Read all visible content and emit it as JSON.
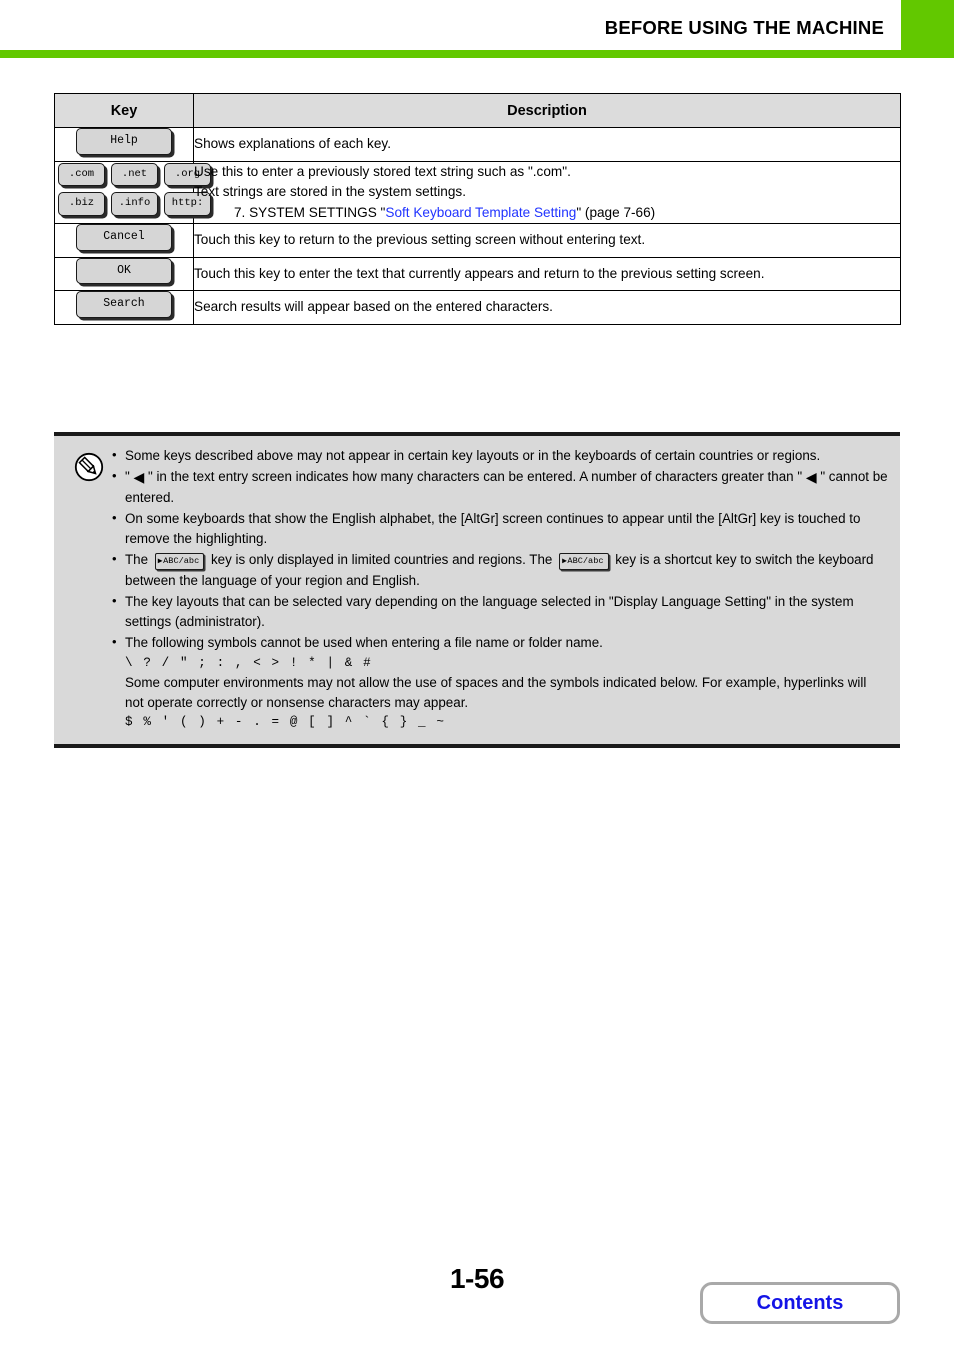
{
  "header": {
    "title": "BEFORE USING THE MACHINE",
    "accent_color": "#62c800"
  },
  "key_table": {
    "columns": [
      "Key",
      "Description"
    ],
    "rows": [
      {
        "keys": [
          [
            "Help"
          ]
        ],
        "description_lines": [
          "Shows explanations of each key."
        ],
        "indented_line": null,
        "link_prefix": null,
        "link_text": null,
        "link_suffix": null
      },
      {
        "keys": [
          [
            ".com",
            ".net",
            ".org"
          ],
          [
            ".biz",
            ".info",
            "http:"
          ]
        ],
        "description_lines": [
          "Use this to enter a previously stored text string such as \".com\".",
          "Text strings are stored in the system settings."
        ],
        "link_prefix": "7. SYSTEM SETTINGS \"",
        "link_text": "Soft Keyboard Template Setting",
        "link_suffix": "\" (page 7-66)"
      },
      {
        "keys": [
          [
            "Cancel"
          ]
        ],
        "description_lines": [
          "Touch this key to return to the previous setting screen without entering text."
        ],
        "link_prefix": null,
        "link_text": null,
        "link_suffix": null
      },
      {
        "keys": [
          [
            "OK"
          ]
        ],
        "description_lines": [
          "Touch this key to enter the text that currently appears and return to the previous setting screen."
        ],
        "link_prefix": null,
        "link_text": null,
        "link_suffix": null
      },
      {
        "keys": [
          [
            "Search"
          ]
        ],
        "description_lines": [
          "Search results will appear based on the entered characters."
        ],
        "link_prefix": null,
        "link_text": null,
        "link_suffix": null
      }
    ]
  },
  "note": {
    "icon": "pencil-note-icon",
    "bullets": [
      {
        "id": "b1",
        "text": "Some keys described above may not appear in certain key layouts or in the keyboards of certain countries or regions."
      },
      {
        "id": "b2",
        "part1": "\" ",
        "glyph": "◀",
        "part2": " \" in the text entry screen indicates how many characters can be entered. A number of characters greater than \" ",
        "glyph2": "◀",
        "part3": " \" cannot be entered."
      },
      {
        "id": "b3",
        "text": "On some keyboards that show the English alphabet, the [AltGr] screen continues to appear until the [AltGr] key is touched to remove the highlighting."
      },
      {
        "id": "b4",
        "part1": "The ",
        "key_label": "ABC/abc",
        "part2": " key is only displayed in limited countries and regions. The ",
        "key_label2": "ABC/abc",
        "part3": " key is a shortcut key to switch the keyboard between the language of your region and English."
      },
      {
        "id": "b5",
        "text": "The key layouts that can be selected vary depending on the language selected in \"Display Language Setting\" in the system settings (administrator)."
      },
      {
        "id": "b6",
        "text": "The following symbols cannot be used when entering a file name or folder name.",
        "symbols_line1": "\\ ? / \" ; : , < > ! * | & #",
        "extra_text": "Some computer environments may not allow the use of spaces and the symbols indicated below. For example, hyperlinks will not operate correctly or nonsense characters may appear.",
        "symbols_line2": "$ % ' ( ) + - . = @ [ ] ^ ` { } _ ~"
      }
    ]
  },
  "footer": {
    "page_number": "1-56",
    "contents_label": "Contents",
    "contents_color": "#1414e6"
  }
}
